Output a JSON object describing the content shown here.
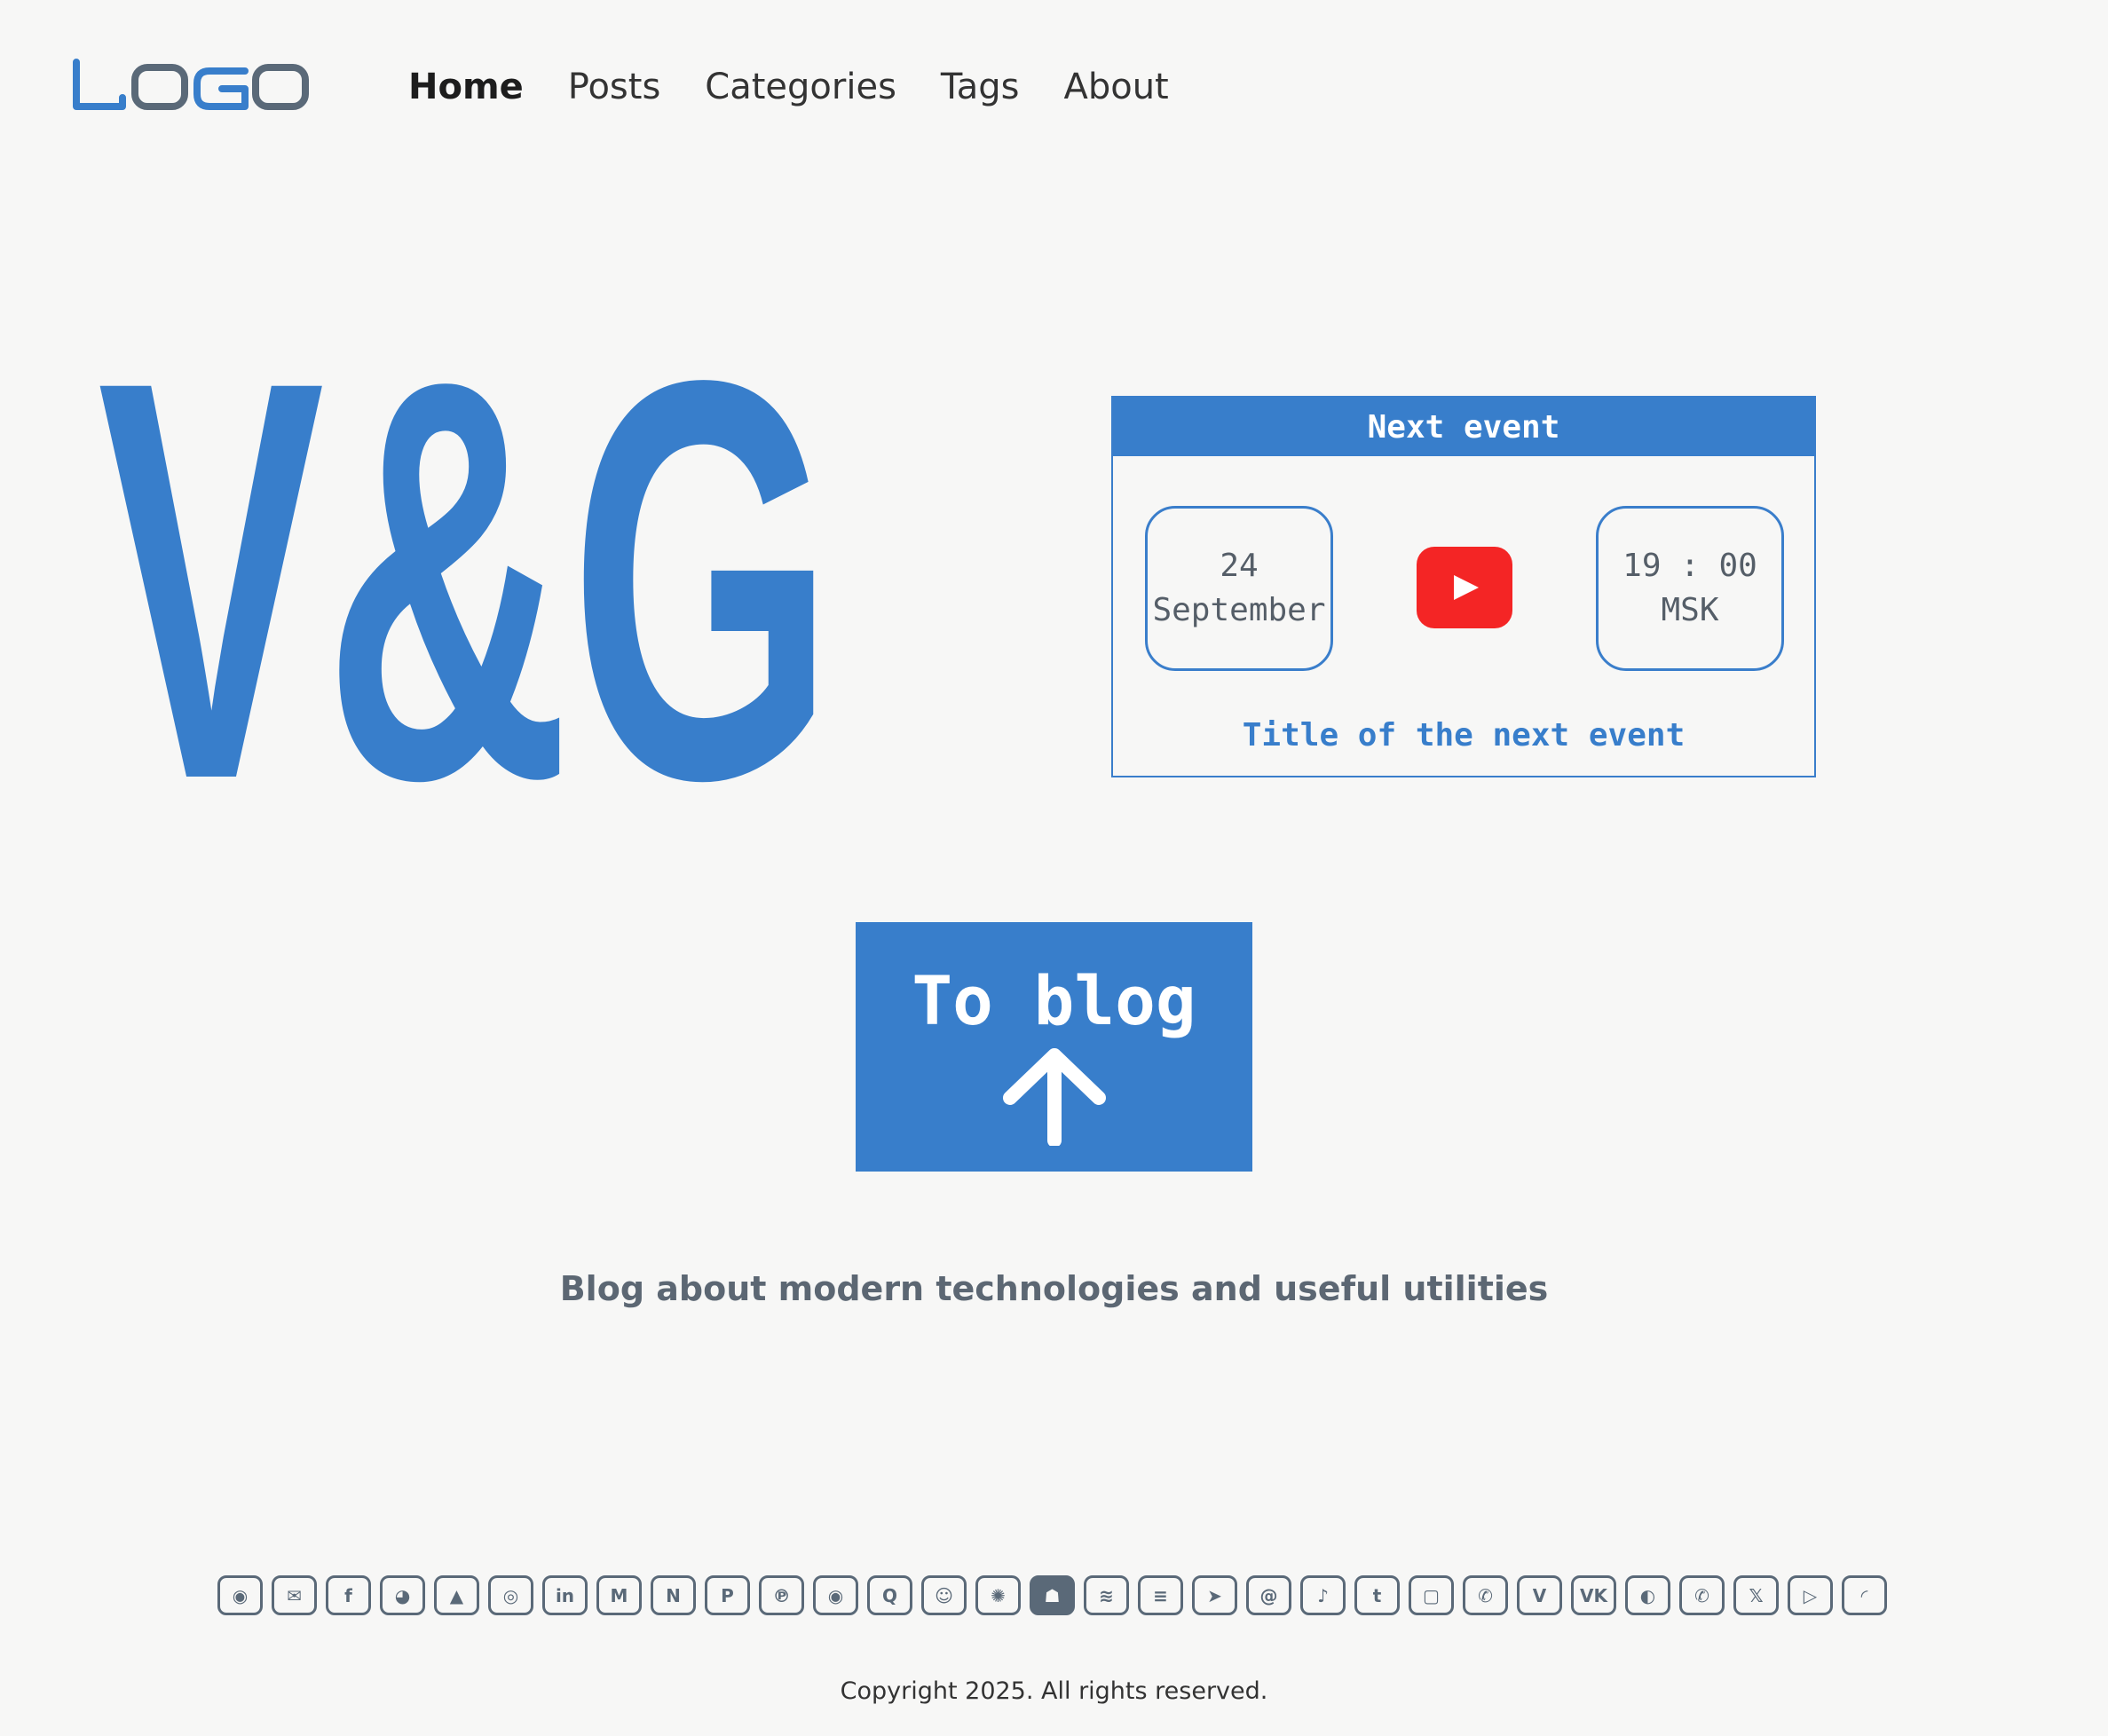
{
  "logo": {
    "text": "LOGO"
  },
  "nav": {
    "items": [
      {
        "label": "Home",
        "active": true
      },
      {
        "label": "Posts",
        "active": false
      },
      {
        "label": "Categories",
        "active": false
      },
      {
        "label": "Tags",
        "active": false
      },
      {
        "label": "About",
        "active": false
      }
    ]
  },
  "hero": {
    "text": "V&G"
  },
  "event": {
    "header": "Next event",
    "date_day": "24",
    "date_month": "September",
    "time": "19 : 00",
    "timezone": "MSK",
    "platform_icon": "youtube-icon",
    "title": "Title of the next event"
  },
  "to_blog": {
    "label": "To blog",
    "icon": "arrow-up-icon"
  },
  "tagline": "Blog about modern technologies and useful utilities",
  "socials": [
    {
      "name": "discord",
      "glyph": "◉"
    },
    {
      "name": "email",
      "glyph": "✉"
    },
    {
      "name": "facebook",
      "glyph": "f"
    },
    {
      "name": "github",
      "glyph": "◕"
    },
    {
      "name": "google-drive",
      "glyph": "▲"
    },
    {
      "name": "instagram",
      "glyph": "◎"
    },
    {
      "name": "linkedin",
      "glyph": "in"
    },
    {
      "name": "medium",
      "glyph": "M"
    },
    {
      "name": "notion",
      "glyph": "N"
    },
    {
      "name": "paypal",
      "glyph": "P"
    },
    {
      "name": "pinterest",
      "glyph": "℗"
    },
    {
      "name": "podcasts",
      "glyph": "◉"
    },
    {
      "name": "quora",
      "glyph": "Q"
    },
    {
      "name": "reddit",
      "glyph": "☺"
    },
    {
      "name": "signal",
      "glyph": "✺"
    },
    {
      "name": "snapchat",
      "glyph": "☗"
    },
    {
      "name": "spotify",
      "glyph": "≋"
    },
    {
      "name": "substack",
      "glyph": "≡"
    },
    {
      "name": "telegram",
      "glyph": "➤"
    },
    {
      "name": "threads",
      "glyph": "@"
    },
    {
      "name": "tiktok",
      "glyph": "♪"
    },
    {
      "name": "tumblr",
      "glyph": "t"
    },
    {
      "name": "twitch",
      "glyph": "▢"
    },
    {
      "name": "viber",
      "glyph": "✆"
    },
    {
      "name": "vimeo",
      "glyph": "V"
    },
    {
      "name": "vk",
      "glyph": "VK"
    },
    {
      "name": "wechat",
      "glyph": "◐"
    },
    {
      "name": "whatsapp",
      "glyph": "✆"
    },
    {
      "name": "x",
      "glyph": "𝕏"
    },
    {
      "name": "youtube",
      "glyph": "▷"
    },
    {
      "name": "rss",
      "glyph": "◜"
    }
  ],
  "copyright": "Copyright 2025. All rights reserved.",
  "colors": {
    "accent": "#387ecb",
    "logo_gray": "#5a6978",
    "youtube_red": "#f42525",
    "background": "#f7f7f6"
  }
}
